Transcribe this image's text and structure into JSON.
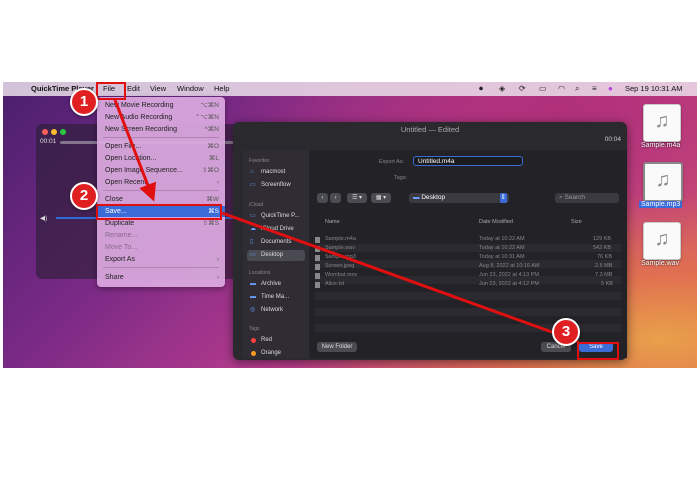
{
  "menubar": {
    "app_name": "QuickTime Player",
    "items": [
      "File",
      "Edit",
      "View",
      "Window",
      "Help"
    ],
    "clock": "Sep 19  10:31 AM"
  },
  "player": {
    "elapsed": "00:01",
    "total": "00:04"
  },
  "window": {
    "title": "Untitled — Edited"
  },
  "file_menu": {
    "items": [
      {
        "label": "New Movie Recording",
        "shortcut": "⌥⌘N"
      },
      {
        "label": "New Audio Recording",
        "shortcut": "⌃⌥⌘N"
      },
      {
        "label": "New Screen Recording",
        "shortcut": "^⌘N"
      },
      {
        "label": "Open File...",
        "shortcut": "⌘O"
      },
      {
        "label": "Open Location...",
        "shortcut": "⌘L"
      },
      {
        "label": "Open Image Sequence...",
        "shortcut": "⇧⌘O"
      },
      {
        "label": "Open Recent",
        "shortcut": "›"
      },
      {
        "label": "Close",
        "shortcut": "⌘W"
      },
      {
        "label": "Save...",
        "shortcut": "⌘S"
      },
      {
        "label": "Duplicate",
        "shortcut": "⇧⌘S"
      },
      {
        "label": "Rename...",
        "shortcut": ""
      },
      {
        "label": "Move To...",
        "shortcut": ""
      },
      {
        "label": "Export As",
        "shortcut": "›"
      },
      {
        "label": "Share",
        "shortcut": "›"
      }
    ]
  },
  "dialog": {
    "export_as_label": "Export As:",
    "export_as_value": "Untitled.m4a",
    "tags_label": "Tags:",
    "location": "Desktop",
    "search_placeholder": "Search",
    "columns": {
      "name": "Name",
      "date": "Date Modified",
      "size": "Size"
    },
    "files": [
      {
        "name": "Sample.m4a",
        "date": "Today at 10:22 AM",
        "size": "129 KB"
      },
      {
        "name": "Sample.wav",
        "date": "Today at 10:22 AM",
        "size": "542 KB"
      },
      {
        "name": "Sample.mp3",
        "date": "Today at 10:31 AM",
        "size": "76 KB"
      },
      {
        "name": "Screen.jpeg",
        "date": "Aug 8, 2022 at 10:16 AM",
        "size": "2.5 MB"
      },
      {
        "name": "Wombat.mov",
        "date": "Jun 23, 2022 at 4:13 PM",
        "size": "7.3 MB"
      },
      {
        "name": "Alice.txt",
        "date": "Jun 23, 2022 at 4:12 PM",
        "size": "5 KB"
      }
    ],
    "new_folder": "New Folder",
    "cancel": "Cancel",
    "save": "Save",
    "sidebar": {
      "favorites_header": "Favorites",
      "icloud_header": "iCloud",
      "locations_header": "Locations",
      "tags_header": "Tags",
      "favorites": [
        "macmost",
        "Screenflow"
      ],
      "icloud": [
        "QuickTime P...",
        "iCloud Drive",
        "Documents",
        "Desktop"
      ],
      "locations": [
        "Archive",
        "Time Ma...",
        "Network"
      ],
      "tags": [
        {
          "label": "Red",
          "color": "#ff4040"
        },
        {
          "label": "Orange",
          "color": "#ff9a20"
        }
      ]
    }
  },
  "desktop_files": [
    "Sample.m4a",
    "Sample.mp3",
    "Sample.wav"
  ],
  "steps": [
    "1",
    "2",
    "3"
  ],
  "colors": {
    "annotation": "#e01010",
    "selection": "#3a6bd6"
  }
}
